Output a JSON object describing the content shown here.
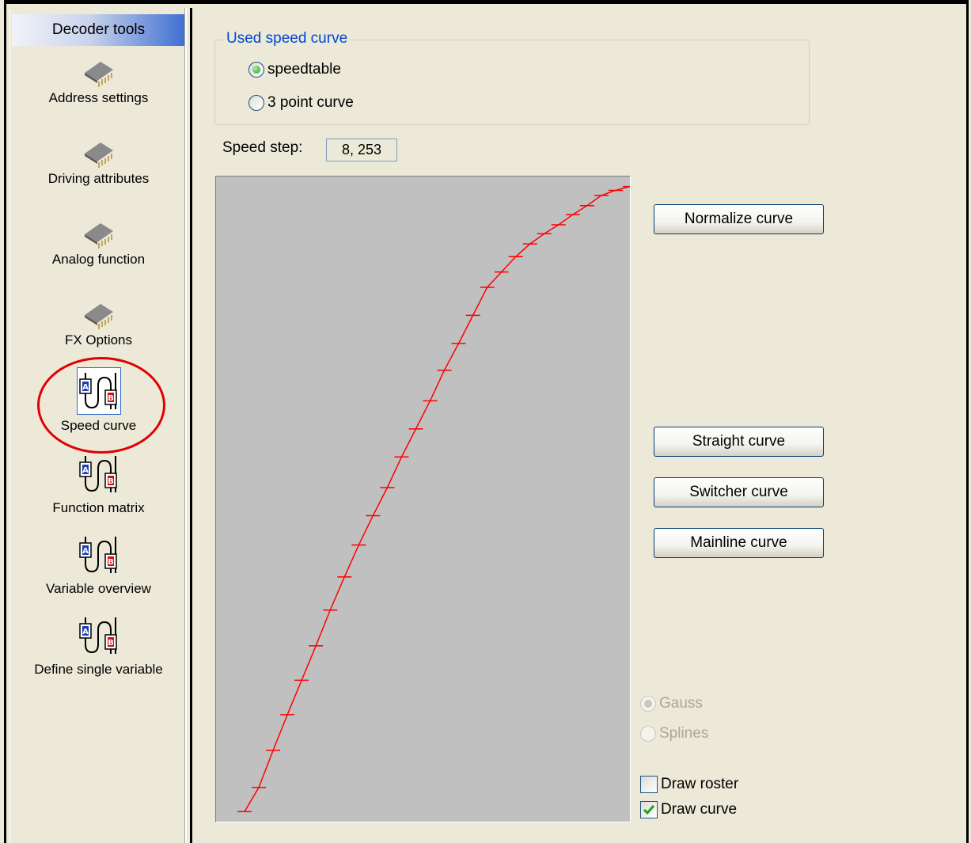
{
  "sidebar": {
    "title": "Decoder tools",
    "items": [
      {
        "label": "Address settings",
        "icon": "chip-icon"
      },
      {
        "label": "Driving attributes",
        "icon": "chip-icon"
      },
      {
        "label": "Analog function",
        "icon": "chip-icon"
      },
      {
        "label": "FX Options",
        "icon": "chip-icon"
      },
      {
        "label": "Speed curve",
        "icon": "switch-ab-icon",
        "selected": true
      },
      {
        "label": "Function matrix",
        "icon": "switch-ab-icon"
      },
      {
        "label": "Variable overview",
        "icon": "switch-ab-icon"
      },
      {
        "label": "Define single variable",
        "icon": "switch-ab-icon"
      }
    ]
  },
  "speed_curve_group": {
    "legend": "Used speed curve",
    "options": [
      {
        "label": "speedtable",
        "checked": true
      },
      {
        "label": "3 point curve",
        "checked": false
      }
    ]
  },
  "speed_step": {
    "label": "Speed step:",
    "value": "8, 253"
  },
  "buttons": {
    "normalize": "Normalize curve",
    "straight": "Straight curve",
    "switcher": "Switcher curve",
    "mainline": "Mainline curve"
  },
  "interpolation": {
    "options": [
      {
        "label": "Gauss",
        "checked": true,
        "disabled": true
      },
      {
        "label": "Splines",
        "checked": false,
        "disabled": true
      }
    ]
  },
  "draw_options": {
    "roster": {
      "label": "Draw roster",
      "checked": false
    },
    "curve": {
      "label": "Draw curve",
      "checked": true
    }
  },
  "colors": {
    "curve": "#ff0000",
    "plot_background": "#c0c0c0",
    "selection_ring": "#e00000"
  },
  "chart_data": {
    "type": "line",
    "title": "",
    "xlabel": "",
    "ylabel": "",
    "x": [
      1,
      2,
      3,
      4,
      5,
      6,
      7,
      8,
      9,
      10,
      11,
      12,
      13,
      14,
      15,
      16,
      17,
      18,
      19,
      20,
      21,
      22,
      23,
      24,
      25,
      26,
      27,
      28
    ],
    "values": [
      1,
      20,
      49,
      77,
      104,
      131,
      159,
      185,
      210,
      233,
      255,
      279,
      301,
      323,
      347,
      368,
      390,
      412,
      424,
      436,
      446,
      454,
      461,
      469,
      476,
      484,
      488,
      491
    ],
    "xlim": [
      0,
      28
    ],
    "ylim": [
      0,
      492
    ],
    "grid": false
  }
}
